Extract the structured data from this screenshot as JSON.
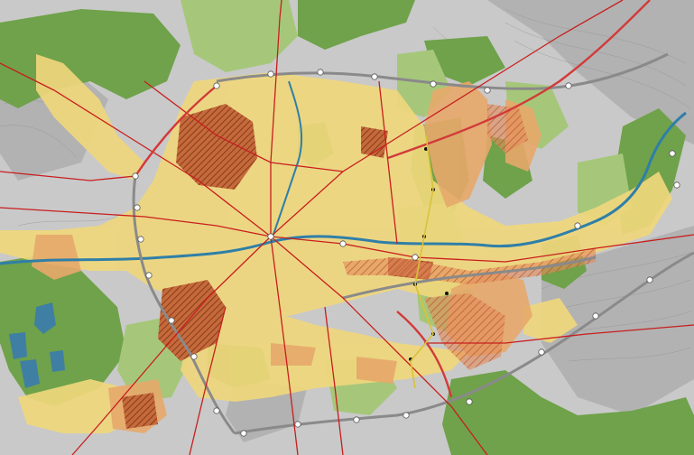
{
  "map": {
    "legend": [],
    "labels": []
  },
  "colors": {
    "terrain": "#c9c9c9",
    "terrain_dark": "#9e9e9e",
    "forest": "#6fa24a",
    "meadow": "#a6c77a",
    "urban_core": "#efd77c",
    "urban_mid": "#e7a86a",
    "urban_dense": "#b5572d",
    "water": "#3f7fa3",
    "river": "#2f7fa8",
    "main_road": "#c81e1e",
    "ring_road": "#d23a3a",
    "motorway": "#8a8a8a",
    "contour": "#8f8f8f",
    "node": "#ffffff"
  }
}
